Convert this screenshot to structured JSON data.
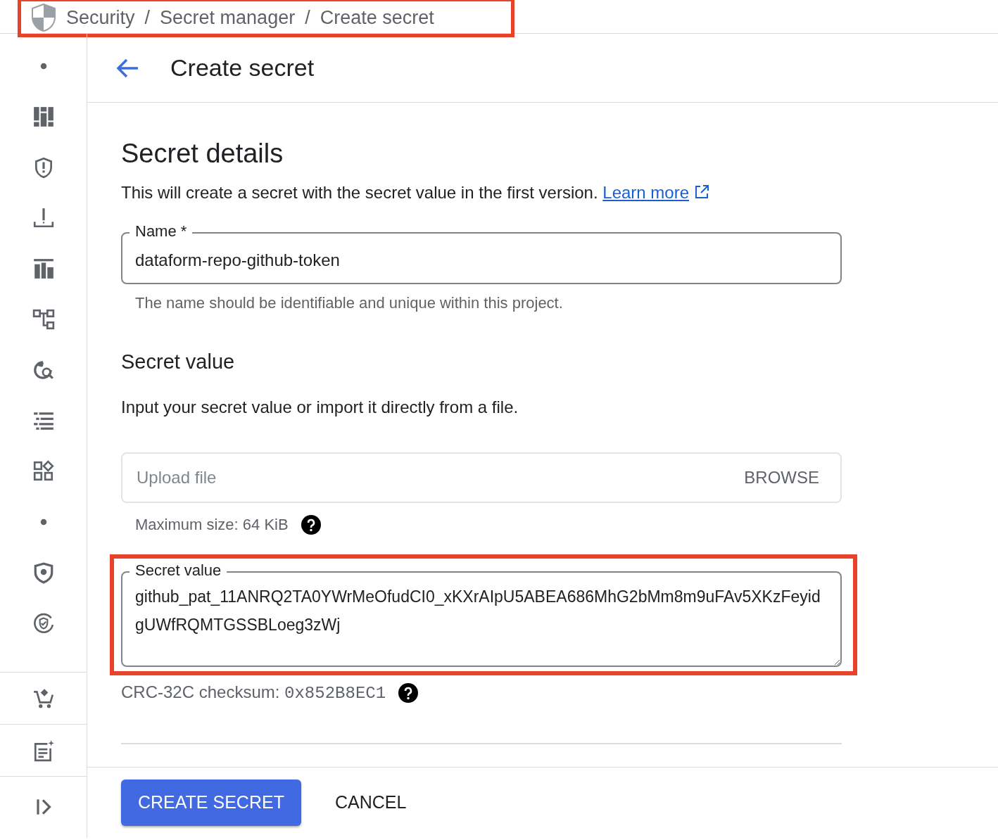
{
  "breadcrumb": {
    "items": [
      "Security",
      "Secret manager",
      "Create secret"
    ],
    "separator": "/",
    "highlighted": true
  },
  "header": {
    "title": "Create secret"
  },
  "details": {
    "heading": "Secret details",
    "description": "This will create a secret with the secret value in the first version.",
    "link": "Learn more"
  },
  "name_field": {
    "label": "Name *",
    "value": "dataform-repo-github-token",
    "hint": "The name should be identifiable and unique within this project."
  },
  "secret_value": {
    "heading": "Secret value",
    "description": "Input your secret value or import it directly from a file."
  },
  "upload": {
    "placeholder": "Upload file",
    "button": "BROWSE",
    "hint": "Maximum size: 64 KiB"
  },
  "value_field": {
    "label": "Secret value",
    "value": "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",
    "highlighted": true
  },
  "checksum": {
    "label": "CRC-32C checksum:",
    "value": "0x852B8EC1"
  },
  "buttons": [
    {
      "label": "CREATE SECRET",
      "kind": "primary"
    },
    {
      "label": "CANCEL",
      "kind": "text"
    }
  ]
}
